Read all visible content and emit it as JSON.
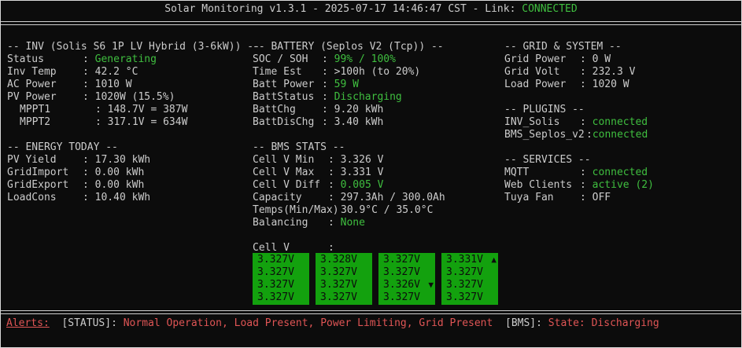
{
  "title": {
    "app": "Solar Monitoring v1.3.1",
    "sep1": " - ",
    "datetime": "2025-07-17 14:46:47 CST",
    "link_label": " - Link: ",
    "link_status": "CONNECTED"
  },
  "inv": {
    "header": "-- INV (Solis S6 1P LV Hybrid (3-6kW)) --",
    "rows": [
      {
        "label": "Status",
        "value": "Generating"
      },
      {
        "label": "Inv Temp",
        "value": "42.2 °C"
      },
      {
        "label": "AC Power",
        "value": "1010 W"
      },
      {
        "label": "PV Power",
        "value": "1020W (15.5%)"
      },
      {
        "label": "MPPT1",
        "value": "148.7V = 387W"
      },
      {
        "label": "MPPT2",
        "value": "317.1V = 634W"
      }
    ]
  },
  "energy": {
    "header": "-- ENERGY TODAY --",
    "rows": [
      {
        "label": "PV Yield",
        "value": "17.30 kWh"
      },
      {
        "label": "GridImport",
        "value": "0.00 kWh"
      },
      {
        "label": "GridExport",
        "value": "0.00 kWh"
      },
      {
        "label": "LoadCons",
        "value": "10.40 kWh"
      }
    ]
  },
  "battery": {
    "header": "-- BATTERY (Seplos V2 (Tcp)) --",
    "rows": [
      {
        "label": "SOC / SOH",
        "value": "99% / 100%"
      },
      {
        "label": "Time Est",
        "value": ">100h (to 20%)"
      },
      {
        "label": "Batt Power",
        "value": "59 W"
      },
      {
        "label": "BattStatus",
        "value": "Discharging"
      },
      {
        "label": "BattChg",
        "value": "9.20 kWh"
      },
      {
        "label": "BattDisChg",
        "value": "3.40 kWh"
      }
    ]
  },
  "bms": {
    "header": "-- BMS STATS --",
    "rows": [
      {
        "label": "Cell V Min",
        "value": "3.326 V"
      },
      {
        "label": "Cell V Max",
        "value": "3.331 V"
      },
      {
        "label": "Cell V Diff",
        "value": "0.005 V"
      },
      {
        "label": "Capacity",
        "value": "297.3Ah / 300.0Ah"
      },
      {
        "label": "Temps(Min/Max)",
        "value": "30.9°C / 35.0°C"
      },
      {
        "label": "Balancing",
        "value": "None"
      }
    ],
    "cellv_label": "Cell V",
    "cellv_colon": ":",
    "cells": [
      [
        "3.327V",
        "3.327V",
        "3.327V",
        "3.327V"
      ],
      [
        "3.328V",
        "3.327V",
        "3.327V",
        "3.327V"
      ],
      [
        "3.327V",
        "3.327V",
        "3.326V",
        "3.327V"
      ],
      [
        "3.331V",
        "3.327V",
        "3.327V",
        "3.327V"
      ]
    ]
  },
  "grid": {
    "header": "-- GRID & SYSTEM --",
    "rows": [
      {
        "label": "Grid Power",
        "value": "0 W"
      },
      {
        "label": "Grid Volt",
        "value": "232.3 V"
      },
      {
        "label": "Load Power",
        "value": "1020 W"
      }
    ]
  },
  "plugins": {
    "header": "-- PLUGINS --",
    "rows": [
      {
        "label": "INV_Solis",
        "value": "connected"
      },
      {
        "label": "BMS_Seplos_v2",
        "value": "connected"
      }
    ]
  },
  "services": {
    "header": "-- SERVICES --",
    "rows": [
      {
        "label": "MQTT",
        "value": "connected"
      },
      {
        "label": "Web Clients",
        "value": "active (2)"
      },
      {
        "label": "Tuya Fan",
        "value": "OFF"
      }
    ]
  },
  "alerts": {
    "label": "Alerts:",
    "status_tag": "[STATUS]:",
    "status_text": "Normal Operation, Load Present, Power Limiting, Grid Present",
    "bms_tag": "[BMS]:",
    "bms_text": "State: Discharging"
  },
  "colors": {
    "ok": "#3fbf3f",
    "alert": "#e05555",
    "cell_bg": "#13a10e"
  },
  "icons": {
    "up": "scroll-up-arrow-icon",
    "down": "scroll-down-arrow-icon"
  }
}
